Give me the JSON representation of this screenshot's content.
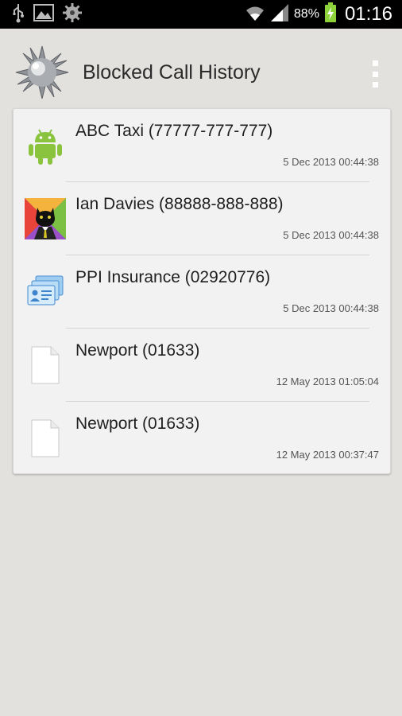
{
  "status_bar": {
    "left_icons": [
      "usb-icon",
      "image-icon",
      "gear-icon"
    ],
    "battery_percent": "88%",
    "time": "01:16"
  },
  "action_bar": {
    "title": "Blocked Call History",
    "app_icon": "spiked-ball-icon",
    "overflow_icon": "overflow-menu-icon"
  },
  "calls": [
    {
      "name": "ABC Taxi (77777-777-777)",
      "date": "5 Dec 2013 00:44:38",
      "icon": "android-icon"
    },
    {
      "name": "Ian Davies (88888-888-888)",
      "date": "5 Dec 2013 00:44:38",
      "icon": "cat-avatar-icon"
    },
    {
      "name": "PPI Insurance (02920776)",
      "date": "5 Dec 2013 00:44:38",
      "icon": "contact-cards-icon"
    },
    {
      "name": "Newport (01633)",
      "date": "12 May 2013 01:05:04",
      "icon": "blank-document-icon"
    },
    {
      "name": "Newport (01633)",
      "date": "12 May 2013 00:37:47",
      "icon": "blank-document-icon"
    }
  ],
  "colors": {
    "status_bar": "#000000",
    "background": "#e3e1de",
    "card": "#f2f2f2",
    "android_green": "#8ac43f",
    "battery_green": "#8ed23b"
  }
}
